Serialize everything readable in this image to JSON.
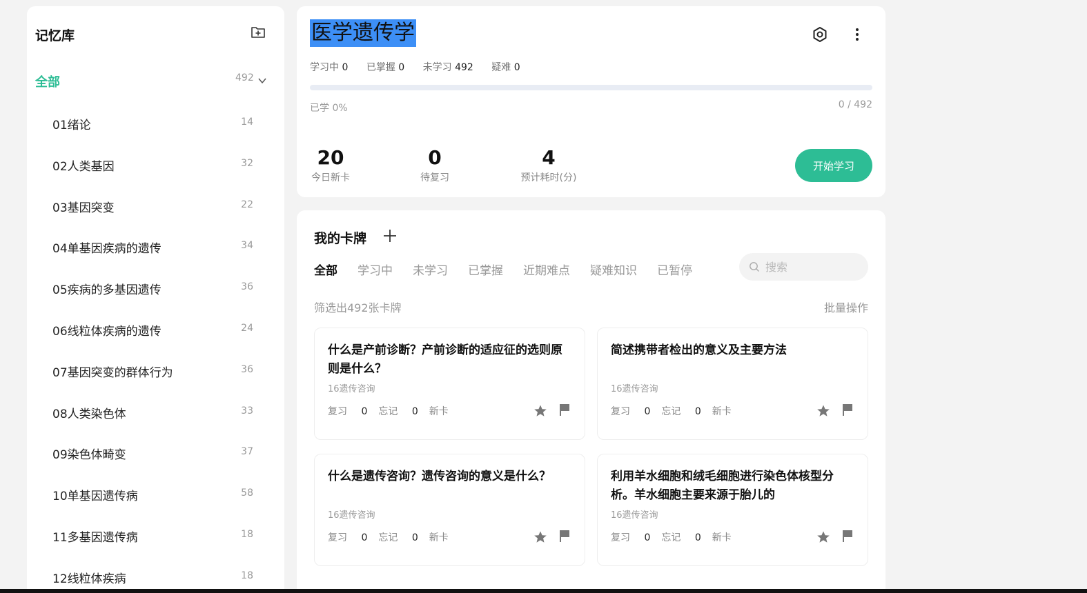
{
  "sidebar": {
    "title": "记忆库",
    "all_label": "全部",
    "all_count": "492",
    "items": [
      {
        "label": "01绪论",
        "count": "14"
      },
      {
        "label": "02人类基因",
        "count": "32"
      },
      {
        "label": "03基因突变",
        "count": "22"
      },
      {
        "label": "04单基因疾病的遗传",
        "count": "34"
      },
      {
        "label": "05疾病的多基因遗传",
        "count": "36"
      },
      {
        "label": "06线粒体疾病的遗传",
        "count": "24"
      },
      {
        "label": "07基因突变的群体行为",
        "count": "36"
      },
      {
        "label": "08人类染色体",
        "count": "33"
      },
      {
        "label": "09染色体畸变",
        "count": "37"
      },
      {
        "label": "10单基因遗传病",
        "count": "58"
      },
      {
        "label": "11多基因遗传病",
        "count": "18"
      },
      {
        "label": "12线粒体疾病",
        "count": "18"
      }
    ]
  },
  "deck": {
    "title": "医学遗传学",
    "stats": {
      "learning_label": "学习中",
      "learning": "0",
      "mastered_label": "已掌握",
      "mastered": "0",
      "unlearned_label": "未学习",
      "unlearned": "492",
      "difficult_label": "疑难",
      "difficult": "0"
    },
    "progress": 0,
    "learned_pct": "已学 0%",
    "learned_frac": "0 / 492",
    "metrics": {
      "new_today": "20",
      "new_today_label": "今日新卡",
      "due": "0",
      "due_label": "待复习",
      "est_time": "4",
      "est_time_label": "预计耗时(分)"
    },
    "start_label": "开始学习"
  },
  "cards": {
    "title": "我的卡牌",
    "tabs": [
      "全部",
      "学习中",
      "未学习",
      "已掌握",
      "近期难点",
      "疑难知识",
      "已暂停"
    ],
    "search_placeholder": "搜索",
    "filter_count": "筛选出492张卡牌",
    "batch_label": "批量操作",
    "review_label": "复习",
    "forget_label": "忘记",
    "items": [
      {
        "question": "什么是产前诊断？产前诊断的适应征的选则原则是什么？",
        "tag": "16遗传咨询",
        "review": "0",
        "forget": "0",
        "status": "新卡"
      },
      {
        "question": "简述携带者检出的意义及主要方法",
        "tag": "16遗传咨询",
        "review": "0",
        "forget": "0",
        "status": "新卡"
      },
      {
        "question": "什么是遗传咨询？遗传咨询的意义是什么？",
        "tag": "16遗传咨询",
        "review": "0",
        "forget": "0",
        "status": "新卡"
      },
      {
        "question": "利用羊水细胞和绒毛细胞进行染色体核型分析。羊水细胞主要来源于胎儿的",
        "tag": "16遗传咨询",
        "review": "0",
        "forget": "0",
        "status": "新卡"
      }
    ]
  },
  "colors": {
    "accent": "#2dbd95",
    "selection": "#3d8ff6"
  }
}
